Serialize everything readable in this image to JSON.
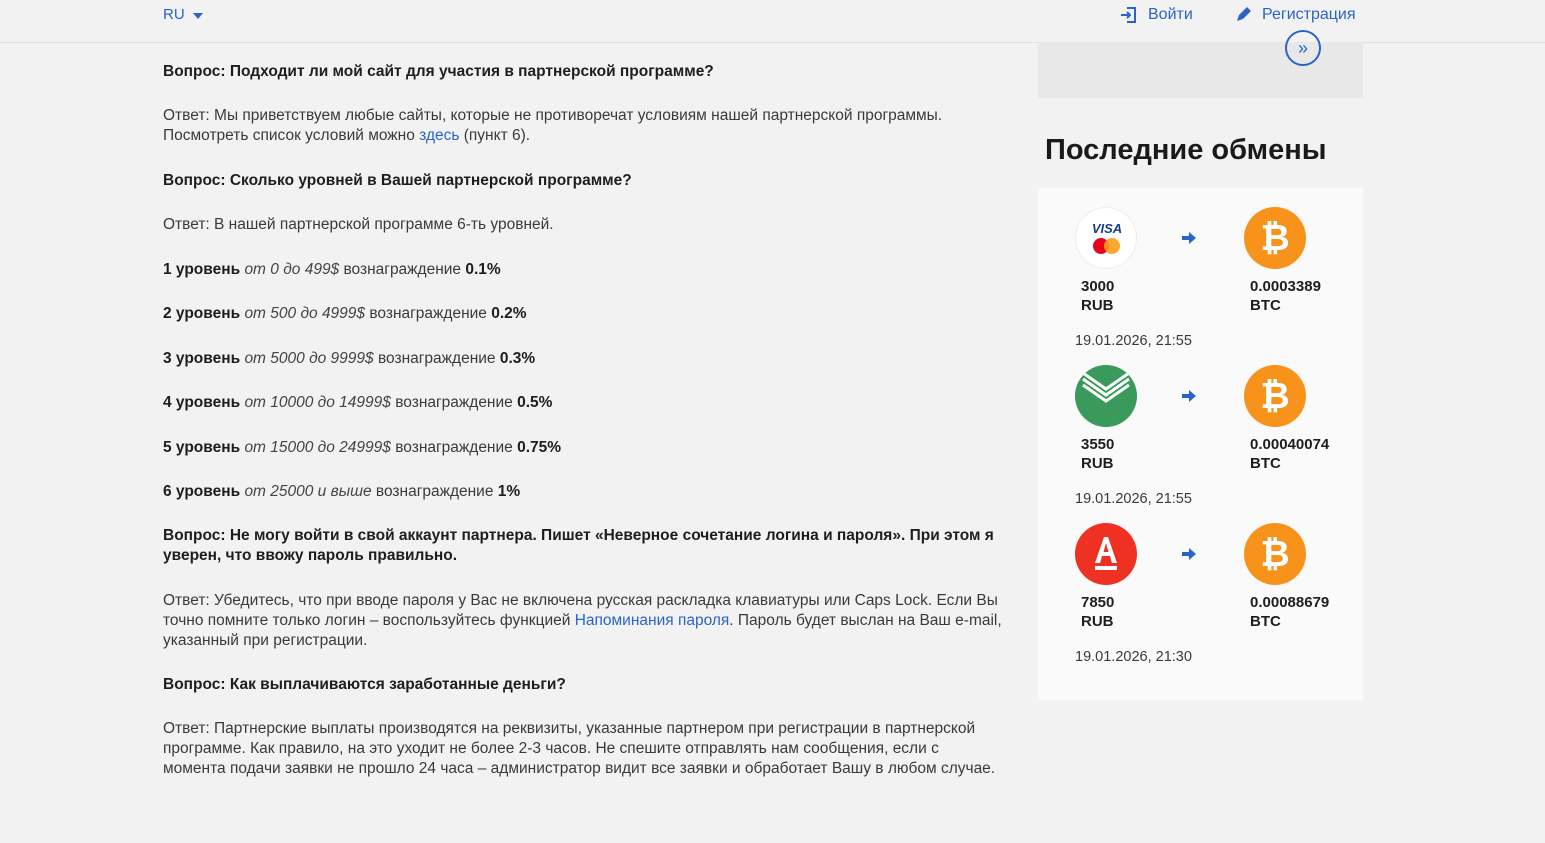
{
  "header": {
    "lang": "RU",
    "login": "Войти",
    "register": "Регистрация"
  },
  "faq": {
    "q1": "Вопрос: Подходит ли мой сайт для участия в партнерской программе?",
    "a1_before": "Ответ: Мы приветствуем любые сайты, которые не противоречат условиям нашей партнерской программы. Посмотреть список условий можно ",
    "a1_link": "здесь",
    "a1_after": " (пункт 6).",
    "q2": "Вопрос: Сколько уровней в Вашей партнерской программе?",
    "a2": "Ответ: В нашей партнерской программе 6-ть уровней.",
    "levels": [
      {
        "name": "1 уровень",
        "range": "от 0 до 499$",
        "label": " вознаграждение ",
        "reward": "0.1%"
      },
      {
        "name": "2 уровень",
        "range": "от 500 до 4999$",
        "label": " вознаграждение ",
        "reward": "0.2%"
      },
      {
        "name": "3 уровень",
        "range": "от 5000 до 9999$",
        "label": " вознаграждение ",
        "reward": "0.3%"
      },
      {
        "name": "4 уровень",
        "range": "от 10000 до 14999$",
        "label": " вознаграждение ",
        "reward": "0.5%"
      },
      {
        "name": "5 уровень",
        "range": "от 15000 до 24999$",
        "label": " вознаграждение ",
        "reward": "0.75%"
      },
      {
        "name": "6 уровень",
        "range": "от 25000 и выше",
        "label": " вознаграждение ",
        "reward": "1%"
      }
    ],
    "q3": "Вопрос: Не могу войти в свой аккаунт партнера. Пишет «Неверное сочетание логина и пароля». При этом я уверен, что ввожу пароль правильно.",
    "a3_before": "Ответ: Убедитесь, что при вводе пароля у Вас не включена русская раскладка клавиатуры или Caps Lock. Если Вы точно помните только логин – воспользуйтесь функцией ",
    "a3_link": "Напоминания пароля",
    "a3_after": ". Пароль будет выслан на Ваш e-mail, указанный при регистрации.",
    "q4": "Вопрос: Как выплачиваются заработанные деньги?",
    "a4": "Ответ: Партнерские выплаты производятся на реквизиты, указанные партнером при регистрации в партнерской программе. Как правило, на это уходит не более 2-3 часов. Не спешите отправлять нам сообщения, если с момента подачи заявки не прошло 24 часа – администратор видит все заявки и обработает Вашу в любом случае."
  },
  "sidebar": {
    "title": "Последние обмены",
    "more_icon": "chevrons-right-icon",
    "exchanges": [
      {
        "from_icon": "visa-mastercard-icon",
        "from_amount": "3000",
        "from_cur": "RUB",
        "to_icon": "bitcoin-icon",
        "to_amount": "0.0003389",
        "to_cur": "BTC",
        "time": "19.01.2026, 21:55"
      },
      {
        "from_icon": "sberbank-icon",
        "from_amount": "3550",
        "from_cur": "RUB",
        "to_icon": "bitcoin-icon",
        "to_amount": "0.00040074",
        "to_cur": "BTC",
        "time": "19.01.2026, 21:55"
      },
      {
        "from_icon": "alfabank-icon",
        "from_amount": "7850",
        "from_cur": "RUB",
        "to_icon": "bitcoin-icon",
        "to_amount": "0.00088679",
        "to_cur": "BTC",
        "time": "19.01.2026, 21:30"
      }
    ]
  },
  "colors": {
    "accent": "#2a64c8",
    "bitcoin": "#f7931a",
    "sber": "#3a9a5b",
    "alfa": "#ef3124"
  }
}
